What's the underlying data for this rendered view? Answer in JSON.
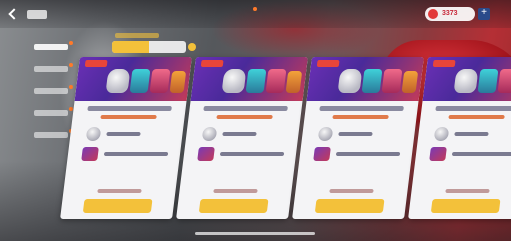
{
  "header": {
    "title": "",
    "tabs": [
      {
        "label": "",
        "active": false
      },
      {
        "label": "",
        "active": false
      },
      {
        "label": "",
        "active": true
      },
      {
        "label": "",
        "active": false
      },
      {
        "label": "",
        "active": false
      }
    ],
    "currency": {
      "amount": "3373",
      "accent": "#c8283a"
    }
  },
  "sidebar": {
    "items": [
      {
        "label": "",
        "active": true
      },
      {
        "label": "",
        "active": false
      },
      {
        "label": "",
        "active": false
      },
      {
        "label": "",
        "active": false
      },
      {
        "label": "",
        "active": false
      }
    ]
  },
  "filter": {
    "caption": "",
    "options": [
      "",
      ""
    ],
    "selected_color": "#f3c13a"
  },
  "cards": [
    {
      "title": "",
      "subtitle": "",
      "reward_1": "",
      "reward_2": "",
      "footer": "",
      "button_label": ""
    },
    {
      "title": "",
      "subtitle": "",
      "reward_1": "",
      "reward_2": "",
      "footer": "",
      "button_label": ""
    },
    {
      "title": "",
      "subtitle": "",
      "reward_1": "",
      "reward_2": "",
      "footer": "",
      "button_label": ""
    },
    {
      "title": "",
      "subtitle": "",
      "reward_1": "",
      "reward_2": "",
      "footer": "",
      "button_label": ""
    }
  ],
  "colors": {
    "banner": "#6a2fb5",
    "button": "#f3c13a",
    "notification_dot": "#ff7a2a",
    "background_accent": "#b52f35"
  }
}
